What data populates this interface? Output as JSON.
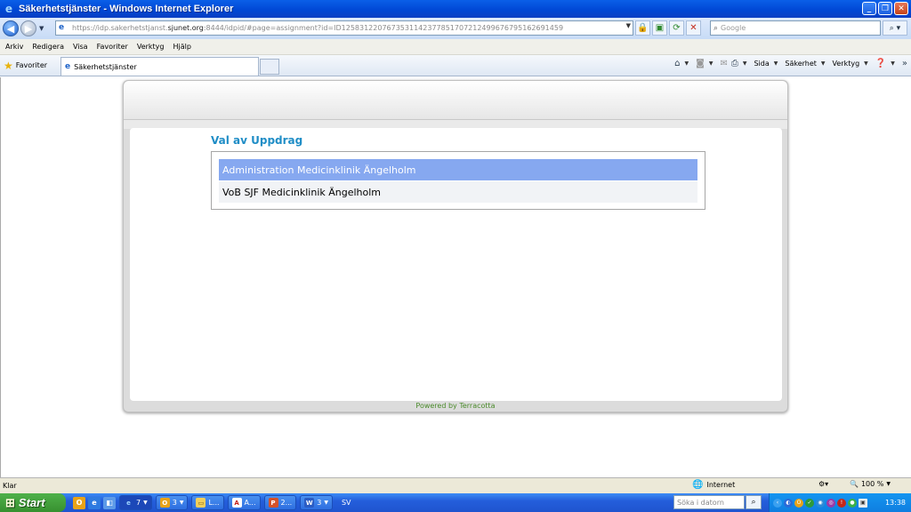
{
  "window": {
    "title": "Säkerhetstjänster - Windows Internet Explorer"
  },
  "address": {
    "url_prefix": "https://idp.sakerhetstjanst.",
    "url_domain": "sjunet.org",
    "url_suffix": ":8444/idpid/#page=assignment?id=ID12583122076735311423778517072124996767951626914​59"
  },
  "search": {
    "placeholder": "Google"
  },
  "menu": [
    "Arkiv",
    "Redigera",
    "Visa",
    "Favoriter",
    "Verktyg",
    "Hjälp"
  ],
  "favorites": {
    "label": "Favoriter"
  },
  "tab": {
    "label": "Säkerhetstjänster"
  },
  "commandbar": {
    "page": "Sida",
    "safety": "Säkerhet",
    "tools": "Verktyg"
  },
  "content": {
    "heading": "Val av Uppdrag",
    "assignments": [
      "Administration Medicinklinik Ängelholm",
      "VoB SJF Medicinklinik Ängelholm"
    ],
    "footer": "Powered by Terracotta"
  },
  "status": {
    "text": "Klar",
    "zone": "Internet",
    "zoom": "100 %"
  },
  "taskbar": {
    "start": "Start",
    "buttons": [
      {
        "count": "7",
        "icon": "ie-icon"
      },
      {
        "count": "3",
        "icon": "outlook-icon"
      },
      {
        "count": "L...",
        "icon": "folder-icon"
      },
      {
        "count": "A...",
        "icon": "acrobat-icon"
      },
      {
        "count": "2...",
        "icon": "powerpoint-icon"
      },
      {
        "count": "3",
        "icon": "word-icon"
      }
    ],
    "lang": "SV",
    "search_placeholder": "Söka i datorn",
    "clock": "13:38"
  }
}
